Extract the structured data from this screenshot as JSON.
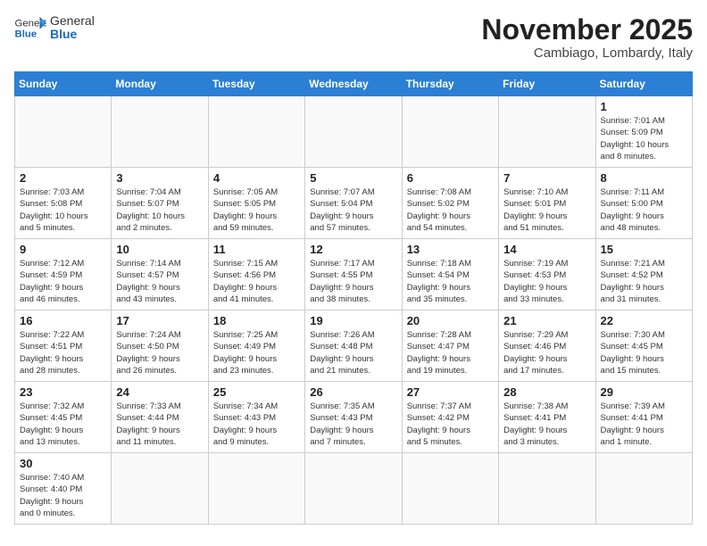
{
  "header": {
    "logo_general": "General",
    "logo_blue": "Blue",
    "month_title": "November 2025",
    "location": "Cambiago, Lombardy, Italy"
  },
  "weekdays": [
    "Sunday",
    "Monday",
    "Tuesday",
    "Wednesday",
    "Thursday",
    "Friday",
    "Saturday"
  ],
  "weeks": [
    [
      {
        "day": "",
        "info": ""
      },
      {
        "day": "",
        "info": ""
      },
      {
        "day": "",
        "info": ""
      },
      {
        "day": "",
        "info": ""
      },
      {
        "day": "",
        "info": ""
      },
      {
        "day": "",
        "info": ""
      },
      {
        "day": "1",
        "info": "Sunrise: 7:01 AM\nSunset: 5:09 PM\nDaylight: 10 hours\nand 8 minutes."
      }
    ],
    [
      {
        "day": "2",
        "info": "Sunrise: 7:03 AM\nSunset: 5:08 PM\nDaylight: 10 hours\nand 5 minutes."
      },
      {
        "day": "3",
        "info": "Sunrise: 7:04 AM\nSunset: 5:07 PM\nDaylight: 10 hours\nand 2 minutes."
      },
      {
        "day": "4",
        "info": "Sunrise: 7:05 AM\nSunset: 5:05 PM\nDaylight: 9 hours\nand 59 minutes."
      },
      {
        "day": "5",
        "info": "Sunrise: 7:07 AM\nSunset: 5:04 PM\nDaylight: 9 hours\nand 57 minutes."
      },
      {
        "day": "6",
        "info": "Sunrise: 7:08 AM\nSunset: 5:02 PM\nDaylight: 9 hours\nand 54 minutes."
      },
      {
        "day": "7",
        "info": "Sunrise: 7:10 AM\nSunset: 5:01 PM\nDaylight: 9 hours\nand 51 minutes."
      },
      {
        "day": "8",
        "info": "Sunrise: 7:11 AM\nSunset: 5:00 PM\nDaylight: 9 hours\nand 48 minutes."
      }
    ],
    [
      {
        "day": "9",
        "info": "Sunrise: 7:12 AM\nSunset: 4:59 PM\nDaylight: 9 hours\nand 46 minutes."
      },
      {
        "day": "10",
        "info": "Sunrise: 7:14 AM\nSunset: 4:57 PM\nDaylight: 9 hours\nand 43 minutes."
      },
      {
        "day": "11",
        "info": "Sunrise: 7:15 AM\nSunset: 4:56 PM\nDaylight: 9 hours\nand 41 minutes."
      },
      {
        "day": "12",
        "info": "Sunrise: 7:17 AM\nSunset: 4:55 PM\nDaylight: 9 hours\nand 38 minutes."
      },
      {
        "day": "13",
        "info": "Sunrise: 7:18 AM\nSunset: 4:54 PM\nDaylight: 9 hours\nand 35 minutes."
      },
      {
        "day": "14",
        "info": "Sunrise: 7:19 AM\nSunset: 4:53 PM\nDaylight: 9 hours\nand 33 minutes."
      },
      {
        "day": "15",
        "info": "Sunrise: 7:21 AM\nSunset: 4:52 PM\nDaylight: 9 hours\nand 31 minutes."
      }
    ],
    [
      {
        "day": "16",
        "info": "Sunrise: 7:22 AM\nSunset: 4:51 PM\nDaylight: 9 hours\nand 28 minutes."
      },
      {
        "day": "17",
        "info": "Sunrise: 7:24 AM\nSunset: 4:50 PM\nDaylight: 9 hours\nand 26 minutes."
      },
      {
        "day": "18",
        "info": "Sunrise: 7:25 AM\nSunset: 4:49 PM\nDaylight: 9 hours\nand 23 minutes."
      },
      {
        "day": "19",
        "info": "Sunrise: 7:26 AM\nSunset: 4:48 PM\nDaylight: 9 hours\nand 21 minutes."
      },
      {
        "day": "20",
        "info": "Sunrise: 7:28 AM\nSunset: 4:47 PM\nDaylight: 9 hours\nand 19 minutes."
      },
      {
        "day": "21",
        "info": "Sunrise: 7:29 AM\nSunset: 4:46 PM\nDaylight: 9 hours\nand 17 minutes."
      },
      {
        "day": "22",
        "info": "Sunrise: 7:30 AM\nSunset: 4:45 PM\nDaylight: 9 hours\nand 15 minutes."
      }
    ],
    [
      {
        "day": "23",
        "info": "Sunrise: 7:32 AM\nSunset: 4:45 PM\nDaylight: 9 hours\nand 13 minutes."
      },
      {
        "day": "24",
        "info": "Sunrise: 7:33 AM\nSunset: 4:44 PM\nDaylight: 9 hours\nand 11 minutes."
      },
      {
        "day": "25",
        "info": "Sunrise: 7:34 AM\nSunset: 4:43 PM\nDaylight: 9 hours\nand 9 minutes."
      },
      {
        "day": "26",
        "info": "Sunrise: 7:35 AM\nSunset: 4:43 PM\nDaylight: 9 hours\nand 7 minutes."
      },
      {
        "day": "27",
        "info": "Sunrise: 7:37 AM\nSunset: 4:42 PM\nDaylight: 9 hours\nand 5 minutes."
      },
      {
        "day": "28",
        "info": "Sunrise: 7:38 AM\nSunset: 4:41 PM\nDaylight: 9 hours\nand 3 minutes."
      },
      {
        "day": "29",
        "info": "Sunrise: 7:39 AM\nSunset: 4:41 PM\nDaylight: 9 hours\nand 1 minute."
      }
    ],
    [
      {
        "day": "30",
        "info": "Sunrise: 7:40 AM\nSunset: 4:40 PM\nDaylight: 9 hours\nand 0 minutes."
      },
      {
        "day": "",
        "info": ""
      },
      {
        "day": "",
        "info": ""
      },
      {
        "day": "",
        "info": ""
      },
      {
        "day": "",
        "info": ""
      },
      {
        "day": "",
        "info": ""
      },
      {
        "day": "",
        "info": ""
      }
    ]
  ]
}
